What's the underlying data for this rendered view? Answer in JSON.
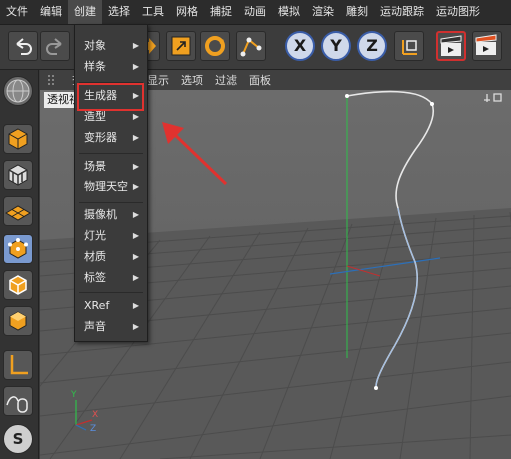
{
  "menubar": {
    "items": [
      "文件",
      "编辑",
      "创建",
      "选择",
      "工具",
      "网格",
      "捕捉",
      "动画",
      "模拟",
      "渲染",
      "雕刻",
      "运动跟踪",
      "运动图形"
    ]
  },
  "viewport_menu": {
    "items": [
      "查",
      "显示",
      "选项",
      "过滤",
      "面板"
    ],
    "view_label": "透视视"
  },
  "dropdown": {
    "items": [
      {
        "label": "对象",
        "submenu": true
      },
      {
        "label": "样条",
        "submenu": true
      },
      {
        "label": "生成器",
        "submenu": true,
        "highlighted": true
      },
      {
        "label": "造型",
        "submenu": true
      },
      {
        "label": "变形器",
        "submenu": true
      },
      {
        "label": "场景",
        "submenu": true
      },
      {
        "label": "物理天空",
        "submenu": true
      },
      {
        "label": "摄像机",
        "submenu": true
      },
      {
        "label": "灯光",
        "submenu": true
      },
      {
        "label": "材质",
        "submenu": true
      },
      {
        "label": "标签",
        "submenu": true
      },
      {
        "label": "XRef",
        "submenu": true
      },
      {
        "label": "声音",
        "submenu": true
      }
    ]
  },
  "toolbar": {
    "axis_x": "X",
    "axis_y": "Y",
    "axis_z": "Z"
  },
  "leftbar": {
    "snap_label": "S"
  },
  "viewport": {
    "axis_y": "Y",
    "axis_x": "X",
    "axis_z": "Z"
  },
  "colors": {
    "annotation_red": "#e0322f",
    "menubar_bg": "#2c2c2c",
    "viewport_bg": "#5a5a5a",
    "accent_orange": "#f0a020",
    "axis_blue": "#2c6fb8"
  }
}
